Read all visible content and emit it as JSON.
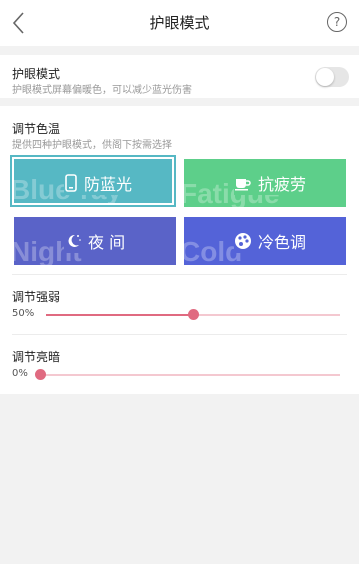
{
  "header": {
    "title": "护眼模式",
    "help_symbol": "?",
    "back_icon": "chevron-left-icon",
    "help_icon": "question-circle-icon"
  },
  "eye_mode": {
    "title": "护眼模式",
    "subtitle": "护眼模式屏幕偏暖色，可以减少蓝光伤害",
    "enabled": false
  },
  "color_temp": {
    "title": "调节色温",
    "subtitle": "提供四种护眼模式，供阁下按需选择",
    "modes": [
      {
        "label": "防蓝光",
        "bg_text": "Blue-ray",
        "icon": "phone-icon",
        "color": "#56b8c4",
        "selected": true
      },
      {
        "label": "抗疲劳",
        "bg_text": "Fatigue",
        "icon": "coffee-cup-icon",
        "color": "#5dcf8a",
        "selected": false
      },
      {
        "label": "夜 间",
        "bg_text": "Night",
        "icon": "moon-stars-icon",
        "color": "#5a63c8",
        "selected": false
      },
      {
        "label": "冷色调",
        "bg_text": "Cold",
        "icon": "palette-icon",
        "color": "#5463d8",
        "selected": false
      }
    ]
  },
  "intensity": {
    "title": "调节强弱",
    "value_label": "50%",
    "value": 0.5
  },
  "brightness": {
    "title": "调节亮暗",
    "value_label": "0%",
    "value": 0
  },
  "colors": {
    "accent": "#e06a80",
    "track": "#f4c8d0"
  }
}
